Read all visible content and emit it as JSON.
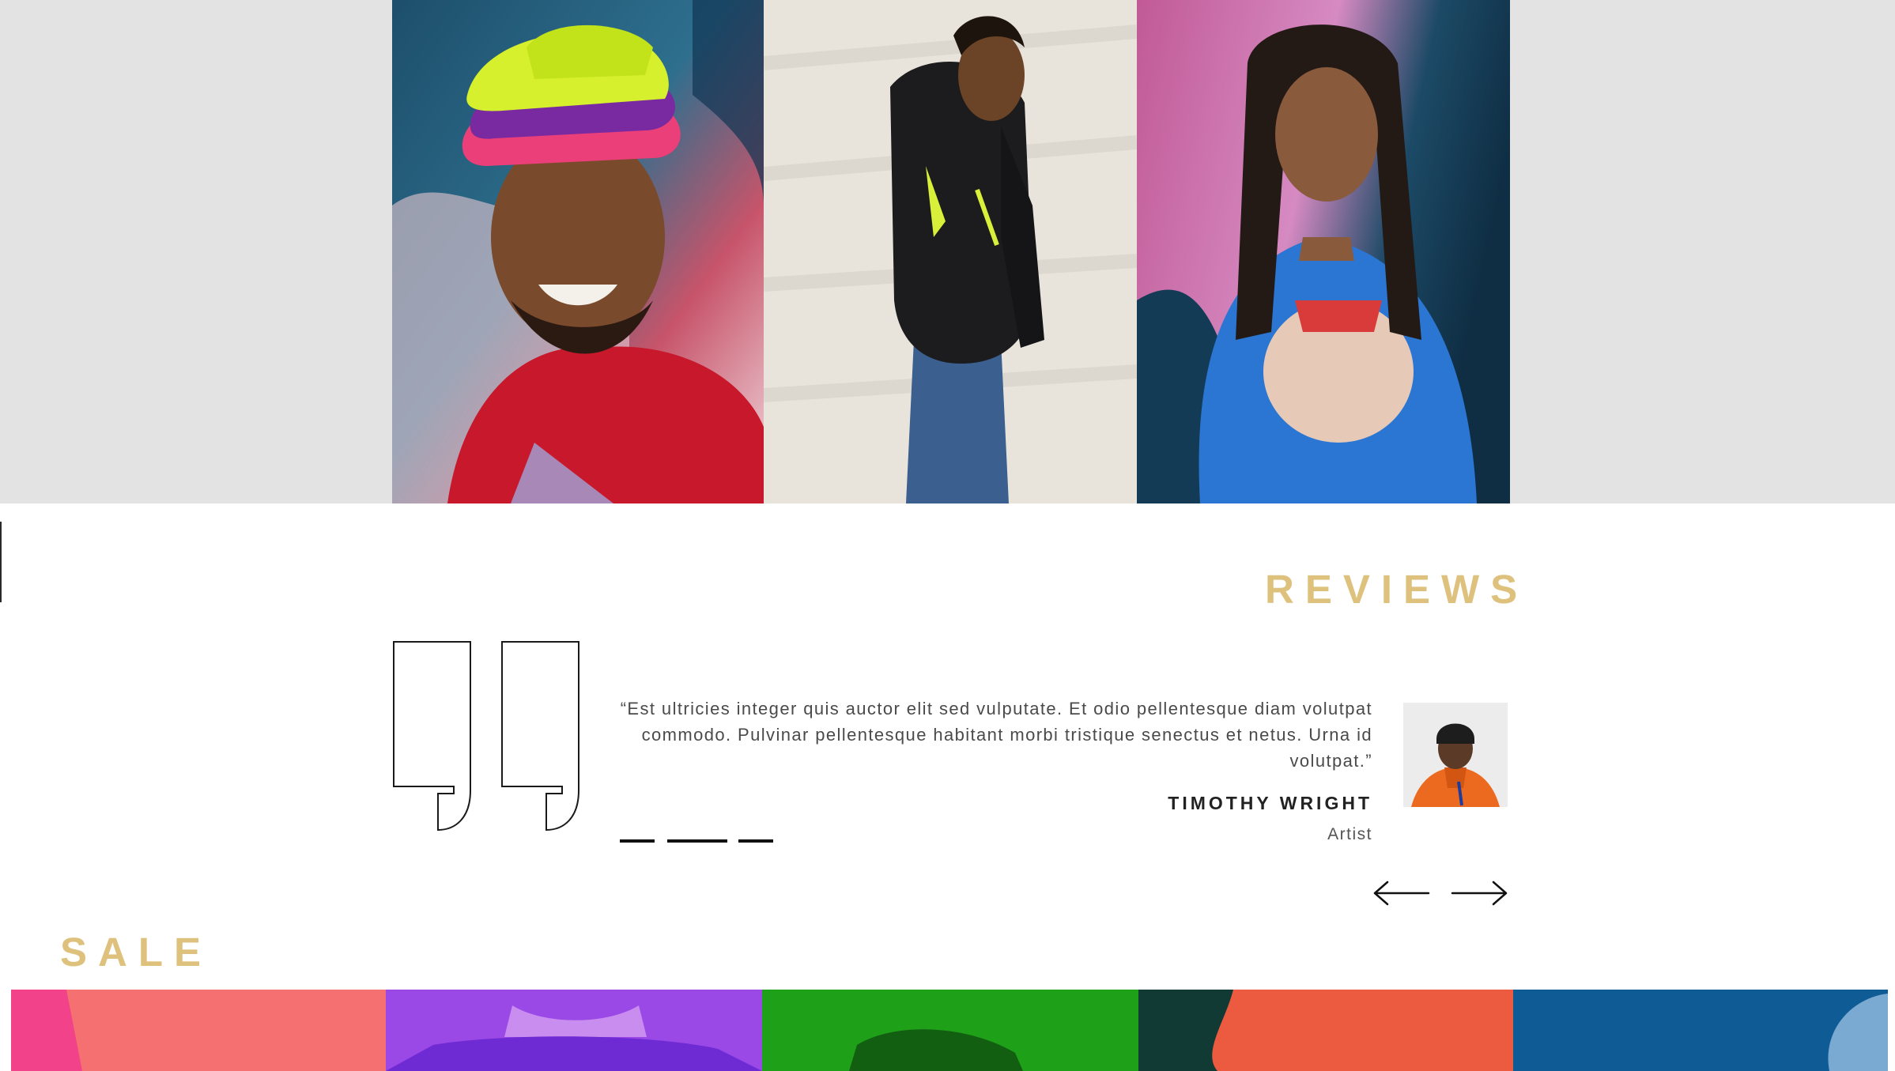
{
  "gallery": {
    "tiles": [
      {
        "name": "hat-stack-red-hoodie-photo"
      },
      {
        "name": "black-hoodie-photo"
      },
      {
        "name": "blue-tee-photo"
      }
    ]
  },
  "reviews": {
    "title": "REVIEWS",
    "quote": "“Est ultricies integer quis auctor elit sed vulputate. Et odio pellentesque diam volutpat commodo. Pulvinar pellentesque habitant morbi tristique senectus et netus. Urna id volutpat.”",
    "reviewer": {
      "name": "TIMOTHY WRIGHT",
      "role": "Artist"
    },
    "pagination_count": 3,
    "prev_icon": "arrow-left-icon",
    "next_icon": "arrow-right-icon"
  },
  "sale": {
    "title": "SALE",
    "tiles": [
      "pink",
      "purple",
      "green",
      "orange",
      "blue"
    ]
  },
  "colors": {
    "accent": "#dec17c",
    "hero_band": "#e3e3e4",
    "text": "#4a4a4a",
    "heading_dark": "#222222"
  }
}
